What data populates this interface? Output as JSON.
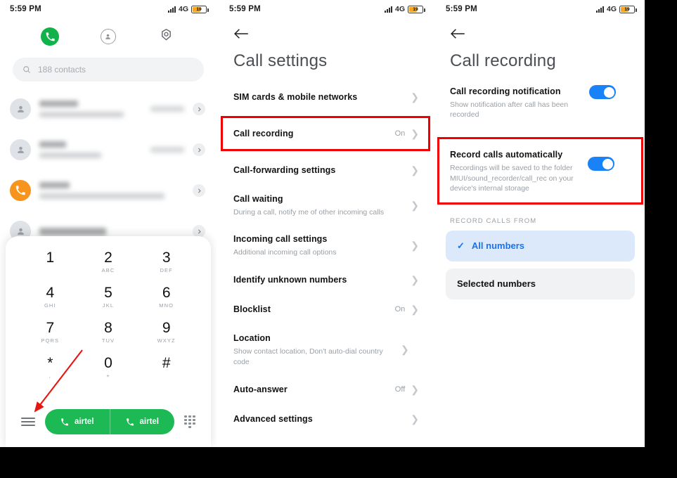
{
  "status_bar": {
    "time": "5:59 PM",
    "network": "4G",
    "battery_level": "19",
    "icons": [
      "signal-bars-icon",
      "network-type-icon",
      "battery-icon"
    ]
  },
  "accent": {
    "green": "#1db954",
    "blue": "#1a82f7",
    "highlight_red": "#f00000",
    "orange": "#f7941e"
  },
  "dialer": {
    "tabs": [
      {
        "name": "keypad",
        "icon": "phone-icon",
        "active": true
      },
      {
        "name": "contacts",
        "icon": "person-icon",
        "active": false
      },
      {
        "name": "settings",
        "icon": "gear-icon",
        "active": false
      }
    ],
    "search": {
      "icon": "search-icon",
      "placeholder": "188 contacts",
      "value": ""
    },
    "contacts_count": "188 contacts",
    "contact_rows": [
      {
        "avatar": "person-avatar",
        "redacted": true
      },
      {
        "avatar": "person-avatar",
        "redacted": true
      },
      {
        "avatar": "call-avatar-orange",
        "redacted": true
      },
      {
        "avatar": "person-avatar",
        "redacted": true
      }
    ],
    "keypad": [
      {
        "digit": "1",
        "letters": ""
      },
      {
        "digit": "2",
        "letters": "ABC"
      },
      {
        "digit": "3",
        "letters": "DEF"
      },
      {
        "digit": "4",
        "letters": "GHI"
      },
      {
        "digit": "5",
        "letters": "JKL"
      },
      {
        "digit": "6",
        "letters": "MNO"
      },
      {
        "digit": "7",
        "letters": "PQRS"
      },
      {
        "digit": "8",
        "letters": "TUV"
      },
      {
        "digit": "9",
        "letters": "WXYZ"
      },
      {
        "digit": "*",
        "letters": ","
      },
      {
        "digit": "0",
        "letters": "+"
      },
      {
        "digit": "#",
        "letters": ""
      }
    ],
    "call_buttons": [
      {
        "label": "airtel",
        "sim": "1",
        "icon": "phone-sim1-icon"
      },
      {
        "label": "airtel",
        "sim": "2",
        "icon": "phone-sim2-icon"
      }
    ],
    "menu_icon": "hamburger-menu-icon",
    "keypad_toggle_icon": "keypad-icon"
  },
  "call_settings": {
    "back_icon": "back-arrow-icon",
    "title": "Call settings",
    "highlighted_item": "Call recording",
    "items": [
      {
        "title": "SIM cards & mobile networks",
        "subtitle": "",
        "value": "",
        "highlighted": false
      },
      {
        "title": "Call recording",
        "subtitle": "",
        "value": "On",
        "highlighted": true
      },
      {
        "title": "Call-forwarding settings",
        "subtitle": "",
        "value": "",
        "highlighted": false
      },
      {
        "title": "Call waiting",
        "subtitle": "During a call, notify me of other incoming calls",
        "value": "",
        "highlighted": false
      },
      {
        "title": "Incoming call settings",
        "subtitle": "Additional incoming call options",
        "value": "",
        "highlighted": false
      },
      {
        "title": "Identify unknown numbers",
        "subtitle": "",
        "value": "",
        "highlighted": false
      },
      {
        "title": "Blocklist",
        "subtitle": "",
        "value": "On",
        "highlighted": false
      },
      {
        "title": "Location",
        "subtitle": "Show contact location, Don't auto-dial country code",
        "value": "",
        "highlighted": false
      },
      {
        "title": "Auto-answer",
        "subtitle": "",
        "value": "Off",
        "highlighted": false
      },
      {
        "title": "Advanced settings",
        "subtitle": "",
        "value": "",
        "highlighted": false
      }
    ]
  },
  "call_recording": {
    "back_icon": "back-arrow-icon",
    "title": "Call recording",
    "toggles": [
      {
        "title": "Call recording notification",
        "subtitle": "Show notification after call has been recorded",
        "on": true,
        "highlighted": false
      },
      {
        "title": "Record calls automatically",
        "subtitle": "Recordings will be saved to the folder MIUI/sound_recorder/call_rec on your device's internal storage",
        "on": true,
        "highlighted": true
      }
    ],
    "section_label": "RECORD CALLS FROM",
    "options": [
      {
        "label": "All numbers",
        "selected": true,
        "icon": "check-icon"
      },
      {
        "label": "Selected numbers",
        "selected": false,
        "icon": ""
      }
    ]
  },
  "annotations": {
    "arrow": {
      "name": "red-pointer-arrow",
      "from": "keypad-*-area",
      "to": "hamburger-menu-icon"
    }
  }
}
